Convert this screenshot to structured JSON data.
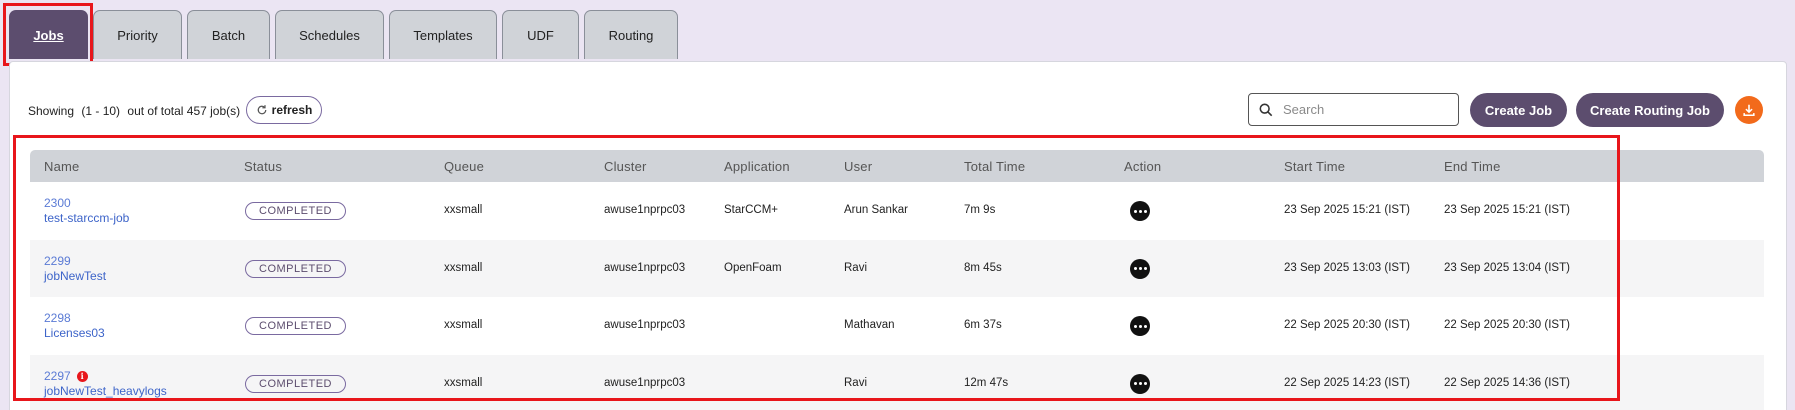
{
  "tabs": [
    {
      "label": "Jobs",
      "active": true
    },
    {
      "label": "Priority",
      "active": false
    },
    {
      "label": "Batch",
      "active": false
    },
    {
      "label": "Schedules",
      "active": false
    },
    {
      "label": "Templates",
      "active": false
    },
    {
      "label": "UDF",
      "active": false
    },
    {
      "label": "Routing",
      "active": false
    }
  ],
  "summary": {
    "showing_label": "Showing",
    "range": "(1 - 10)",
    "total_text": "out of total 457 job(s)"
  },
  "toolbar": {
    "refresh_label": "refresh",
    "search_placeholder": "Search",
    "create_job_label": "Create Job",
    "create_routing_job_label": "Create Routing Job",
    "download_icon": "download-icon"
  },
  "table": {
    "columns": [
      "Name",
      "Status",
      "Queue",
      "Cluster",
      "Application",
      "User",
      "Total Time",
      "Action",
      "Start Time",
      "End Time"
    ],
    "rows": [
      {
        "id": "2300",
        "name": "test-starccm-job",
        "warning": false,
        "status": "COMPLETED",
        "queue": "xxsmall",
        "cluster": "awuse1nprpc03",
        "application": "StarCCM+",
        "user": "Arun Sankar",
        "total_time": "7m 9s",
        "start_time": "23 Sep 2025 15:21 (IST)",
        "end_time": "23 Sep 2025 15:21 (IST)"
      },
      {
        "id": "2299",
        "name": "jobNewTest",
        "warning": false,
        "status": "COMPLETED",
        "queue": "xxsmall",
        "cluster": "awuse1nprpc03",
        "application": "OpenFoam",
        "user": "Ravi",
        "total_time": "8m 45s",
        "start_time": "23 Sep 2025 13:03 (IST)",
        "end_time": "23 Sep 2025 13:04 (IST)"
      },
      {
        "id": "2298",
        "name": "Licenses03",
        "warning": false,
        "status": "COMPLETED",
        "queue": "xxsmall",
        "cluster": "awuse1nprpc03",
        "application": "",
        "user": "Mathavan",
        "total_time": "6m 37s",
        "start_time": "22 Sep 2025 20:30 (IST)",
        "end_time": "22 Sep 2025 20:30 (IST)"
      },
      {
        "id": "2297",
        "name": "jobNewTest_heavylogs",
        "warning": true,
        "status": "COMPLETED",
        "queue": "xxsmall",
        "cluster": "awuse1nprpc03",
        "application": "",
        "user": "Ravi",
        "total_time": "12m 47s",
        "start_time": "22 Sep 2025 14:23 (IST)",
        "end_time": "22 Sep 2025 14:36 (IST)"
      }
    ]
  },
  "colors": {
    "accent": "#5c4d6e",
    "highlight": "#e8161b",
    "download": "#f26a1b",
    "link": "#3d64c9"
  }
}
